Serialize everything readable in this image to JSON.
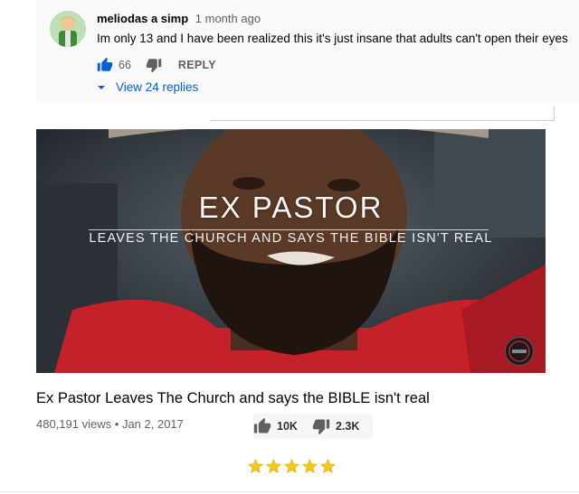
{
  "comment": {
    "author": "meliodas a simp",
    "time": "1 month ago",
    "text": "Im only 13 and I have been realized this it's just insane that adults can't open their eyes",
    "like_count": "66",
    "reply_label": "REPLY",
    "view_replies_label": "View 24 replies",
    "like_icon": "thumbs-up-icon",
    "dislike_icon": "thumbs-down-icon",
    "accent_color": "#065fd4"
  },
  "video": {
    "overlay_title": "EX PASTOR",
    "overlay_subtitle": "LEAVES THE CHURCH AND SAYS THE BIBLE ISN'T REAL",
    "title": "Ex Pastor Leaves The Church and says the BIBLE isn't real",
    "views": "480,191 views",
    "separator": "•",
    "date": "Jan 2, 2017",
    "likes": "10K",
    "dislikes": "2.3K"
  },
  "rating": {
    "stars": 5,
    "max": 5,
    "star_color": "#f5c518"
  }
}
